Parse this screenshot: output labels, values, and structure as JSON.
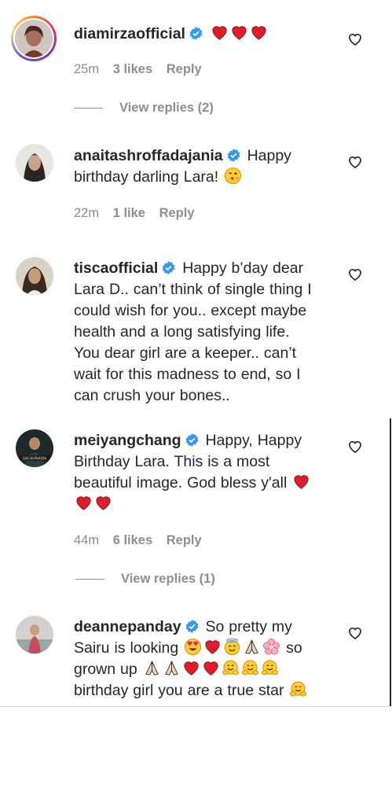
{
  "comments": [
    {
      "username": "diamirzaofficial",
      "text": "",
      "emoji_after": [
        "heart",
        "heart",
        "heart"
      ],
      "time": "25m",
      "likes": "3 likes",
      "reply": "Reply",
      "view_replies": "View replies (2)"
    },
    {
      "username": "anaitashroffadajania",
      "text_lines": [
        "Happy",
        "birthday darling Lara!"
      ],
      "time": "22m",
      "likes": "1 like",
      "reply": "Reply"
    },
    {
      "username": "tiscaofficial",
      "text_lines": [
        "Happy b’day dear",
        "Lara D.. can’t think of single thing I",
        "could wish for you.. except maybe",
        "health and a long satisfying life.",
        "You dear girl are a keeper.. can’t",
        "wait for this madness to end, so I",
        "can crush your bones.."
      ]
    },
    {
      "username": "meiyangchang",
      "text_lines": [
        "Happy, Happy",
        "Birthday Lara. This is a most",
        "beautiful image. God bless y'all"
      ],
      "time": "44m",
      "likes": "6 likes",
      "reply": "Reply",
      "view_replies": "View replies (1)"
    },
    {
      "username": "deannepanday",
      "text_lines": [
        "So pretty my",
        "Sairu is looking",
        "so",
        "grown up",
        "birthday girl you are a true star"
      ]
    }
  ],
  "icons": {
    "verified": "verified-badge-icon",
    "like": "heart-outline-icon"
  },
  "colors": {
    "verified_blue": "#3897f0",
    "heart_red": "#e0245e",
    "meta_gray": "#8e8e8e",
    "text": "#262626"
  }
}
